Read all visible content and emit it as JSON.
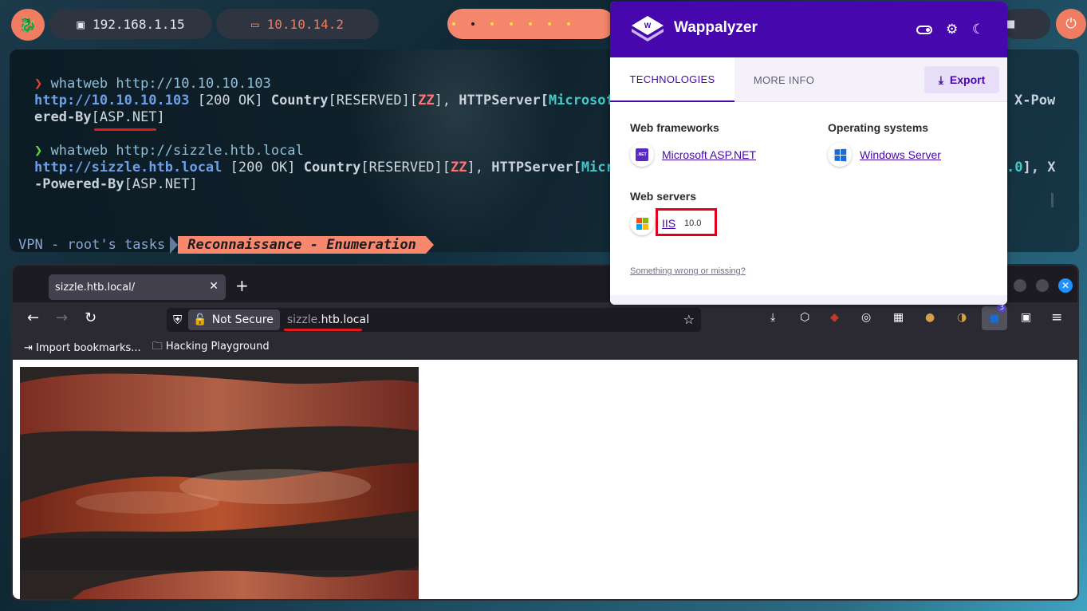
{
  "topbar": {
    "ip_address": "192.168.1.15",
    "vpn_address": "10.10.14.2"
  },
  "terminal": {
    "cmd1": "whatweb http://10.10.10.103",
    "out1_url": "http://10.10.10.103",
    "out1_status": " [200 OK] ",
    "out1_country": "Country",
    "out1_reserved": "[RESERVED][",
    "out1_zz": "ZZ",
    "out1_close": "], ",
    "out1_server": "HTTPServer[",
    "out1_ms": "Microsoft",
    "out1_xpow": "X-Pow",
    "out1_line2_prefix": "ered-By",
    "out1_line2_value": "[ASP.NET]",
    "cmd2": "whatweb http://sizzle.htb.local",
    "out2_url": "http://sizzle.htb.local",
    "out2_status": " [200 OK] ",
    "out2_country": "Country",
    "out2_reserved": "[RESERVED][",
    "out2_zz": "ZZ",
    "out2_close": "], ",
    "out2_server": "HTTPServer[",
    "out2_ms": "Micro",
    "out2_tail_ver": ".0",
    "out2_tail_rest": "], X",
    "out2_line2_prefix": "-Powered-By",
    "out2_line2_value": "[ASP.NET]",
    "prompt_symbol": "❯"
  },
  "statusline": {
    "segment1": "VPN - root's tasks",
    "segment2": "Reconnaissance - Enumeration"
  },
  "browser": {
    "tab_title": "sizzle.htb.local/",
    "not_secure_label": "Not Secure",
    "url_subdomain": "sizzle.",
    "url_domain": "htb.local",
    "bookmarks": [
      {
        "label": "Import bookmarks..."
      },
      {
        "label": "Hacking Playground"
      }
    ],
    "extension_badge": "3"
  },
  "wappalyzer": {
    "title": "Wappalyzer",
    "tabs": {
      "technologies": "TECHNOLOGIES",
      "more_info": "MORE INFO"
    },
    "export_label": "Export",
    "categories": {
      "web_frameworks": {
        "label": "Web frameworks",
        "tech": "Microsoft ASP.NET",
        "icon_text": ".NET"
      },
      "operating_systems": {
        "label": "Operating systems",
        "tech": "Windows Server"
      },
      "web_servers": {
        "label": "Web servers",
        "tech": "IIS",
        "version": "10.0"
      }
    },
    "footer_link": "Something wrong or missing?"
  },
  "colors": {
    "wappalyzer_purple": "#4608ad",
    "kali_orange": "#f07c61",
    "highlight_red": "#e0001b"
  }
}
